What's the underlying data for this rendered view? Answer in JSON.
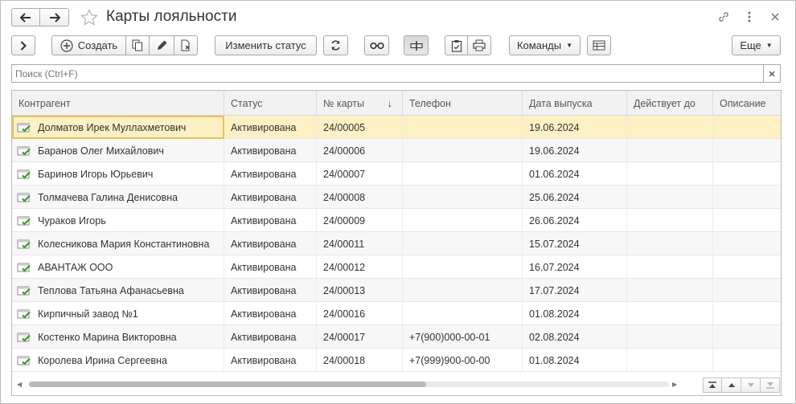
{
  "window": {
    "title": "Карты лояльности"
  },
  "toolbar": {
    "create_label": "Создать",
    "change_status_label": "Изменить статус",
    "commands_label": "Команды",
    "more_label": "Еще"
  },
  "search": {
    "placeholder": "Поиск (Ctrl+F)"
  },
  "table": {
    "columns": [
      "Контрагент",
      "Статус",
      "№ карты",
      "Телефон",
      "Дата выпуска",
      "Действует до",
      "Описание"
    ],
    "sorted_column": "№ карты",
    "sort_direction": "descending-arrow",
    "rows": [
      {
        "counterparty": "Долматов Ирек Муллахметович",
        "status": "Активирована",
        "card": "24/00005",
        "phone": "",
        "issue_date": "19.06.2024",
        "valid_to": "",
        "description": ""
      },
      {
        "counterparty": "Баранов Олег Михайлович",
        "status": "Активирована",
        "card": "24/00006",
        "phone": "",
        "issue_date": "19.06.2024",
        "valid_to": "",
        "description": ""
      },
      {
        "counterparty": "Баринов Игорь Юрьевич",
        "status": "Активирована",
        "card": "24/00007",
        "phone": "",
        "issue_date": "01.06.2024",
        "valid_to": "",
        "description": ""
      },
      {
        "counterparty": "Толмачева Галина Денисовна",
        "status": "Активирована",
        "card": "24/00008",
        "phone": "",
        "issue_date": "25.06.2024",
        "valid_to": "",
        "description": ""
      },
      {
        "counterparty": "Чураков Игорь",
        "status": "Активирована",
        "card": "24/00009",
        "phone": "",
        "issue_date": "26.06.2024",
        "valid_to": "",
        "description": ""
      },
      {
        "counterparty": "Колесникова Мария Константиновна",
        "status": "Активирована",
        "card": "24/00011",
        "phone": "",
        "issue_date": "15.07.2024",
        "valid_to": "",
        "description": ""
      },
      {
        "counterparty": "АВАНТАЖ ООО",
        "status": "Активирована",
        "card": "24/00012",
        "phone": "",
        "issue_date": "16.07.2024",
        "valid_to": "",
        "description": ""
      },
      {
        "counterparty": "Теплова Татьяна Афанасьевна",
        "status": "Активирована",
        "card": "24/00013",
        "phone": "",
        "issue_date": "17.07.2024",
        "valid_to": "",
        "description": ""
      },
      {
        "counterparty": "Кирпичный завод №1",
        "status": "Активирована",
        "card": "24/00016",
        "phone": "",
        "issue_date": "01.08.2024",
        "valid_to": "",
        "description": ""
      },
      {
        "counterparty": "Костенко Марина Викторовна",
        "status": "Активирована",
        "card": "24/00017",
        "phone": "+7(900)000-00-01",
        "issue_date": "02.08.2024",
        "valid_to": "",
        "description": ""
      },
      {
        "counterparty": "Королева Ирина Сергеевна",
        "status": "Активирована",
        "card": "24/00018",
        "phone": "+7(999)900-00-00",
        "issue_date": "01.08.2024",
        "valid_to": "",
        "description": ""
      }
    ]
  },
  "scroll": {
    "horizontal_thumb_fraction": 0.62
  },
  "colors": {
    "selected_row": "#fcf0c4",
    "focus_outline": "#e8c35a",
    "row_icon_green": "#3a9a2c"
  },
  "icons": [
    "back-arrow-icon",
    "forward-arrow-icon",
    "favorite-star-icon",
    "link-icon",
    "more-vertical-icon",
    "close-icon",
    "expand-panel-icon",
    "add-circle-icon",
    "copy-icon",
    "edit-pencil-icon",
    "delete-mark-icon",
    "refresh-icon",
    "glasses-icon",
    "dynamic-list-icon",
    "report-clipboard-icon",
    "print-icon",
    "table-settings-icon"
  ]
}
